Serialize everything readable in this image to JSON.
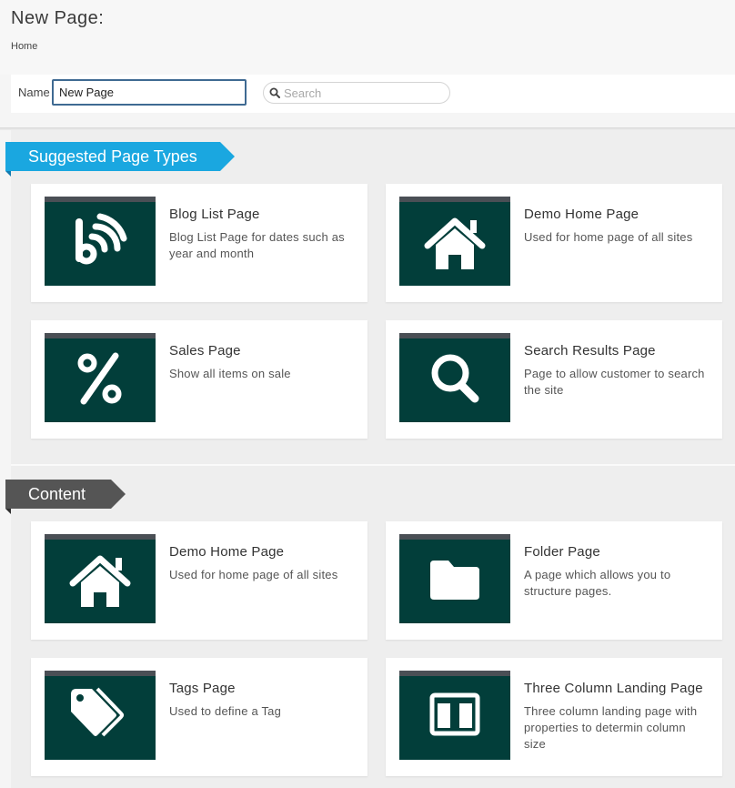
{
  "header": {
    "title": "New Page:",
    "breadcrumb": "Home"
  },
  "form": {
    "name_label": "Name",
    "name_value": "New Page",
    "search_placeholder": "Search"
  },
  "sections": {
    "suggested": {
      "title": "Suggested Page Types",
      "color": "#1aa7e0",
      "cards": [
        {
          "title": "Blog List Page",
          "description": "Blog List Page for dates such as year and month",
          "icon": "rss-blog-icon"
        },
        {
          "title": "Demo Home Page",
          "description": "Used for home page of all sites",
          "icon": "home-icon"
        },
        {
          "title": "Sales Page",
          "description": "Show all items on sale",
          "icon": "percent-icon"
        },
        {
          "title": "Search Results Page",
          "description": "Page to allow customer to search the site",
          "icon": "search-icon"
        }
      ]
    },
    "content": {
      "title": "Content",
      "color": "#555555",
      "cards": [
        {
          "title": "Demo Home Page",
          "description": "Used for home page of all sites",
          "icon": "home-icon"
        },
        {
          "title": "Folder Page",
          "description": "A page which allows you to structure pages.",
          "icon": "folder-icon"
        },
        {
          "title": "Tags Page",
          "description": "Used to define a Tag",
          "icon": "tags-icon"
        },
        {
          "title": "Three Column Landing Page",
          "description": "Three column landing page with properties to determin column size",
          "icon": "columns-icon"
        }
      ]
    }
  },
  "colors": {
    "thumbnail_bg": "#023e3a",
    "thumbnail_bar": "#4a4f55",
    "input_border": "#3f6a92"
  }
}
